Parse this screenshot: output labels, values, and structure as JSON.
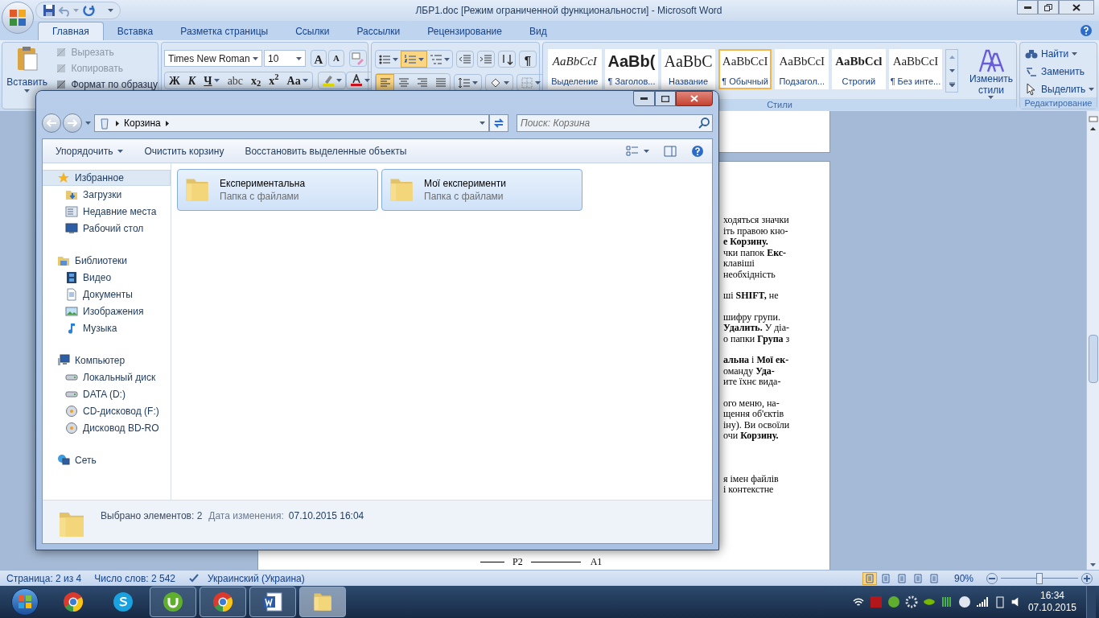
{
  "word": {
    "title": "ЛБР1.doc [Режим ограниченной функциональности] - Microsoft Word",
    "tabs": [
      {
        "label": "Главная",
        "selected": true
      },
      {
        "label": "Вставка",
        "selected": false
      },
      {
        "label": "Разметка страницы",
        "selected": false
      },
      {
        "label": "Ссылки",
        "selected": false
      },
      {
        "label": "Рассылки",
        "selected": false
      },
      {
        "label": "Рецензирование",
        "selected": false
      },
      {
        "label": "Вид",
        "selected": false
      }
    ],
    "clipboard": {
      "paste": "Вставить",
      "cut": {
        "label": "Вырезать",
        "disabled": true
      },
      "copy": {
        "label": "Копировать",
        "disabled": true
      },
      "format_painter": {
        "label": "Формат по образцу",
        "disabled": false
      }
    },
    "font": {
      "family": "Times New Roman",
      "size": "10",
      "grow": "A",
      "shrink": "A",
      "buttons": [
        {
          "label": "Ж",
          "kind": "bold",
          "dropdown": false
        },
        {
          "label": "К",
          "kind": "italic",
          "dropdown": false
        },
        {
          "label": "Ч",
          "kind": "underline",
          "dropdown": true
        },
        {
          "label": "abc",
          "kind": "strike",
          "dropdown": false
        },
        {
          "label": "x$_{2}$",
          "kind": "sub",
          "dropdown": false
        },
        {
          "label": "x$^{2}$",
          "kind": "sup",
          "dropdown": false
        },
        {
          "label": "Aa",
          "kind": "case",
          "dropdown": true
        }
      ]
    },
    "paragraph": {
      "lists": [
        {
          "kind": "bullets",
          "selected": false
        },
        {
          "kind": "numbering",
          "selected": true
        },
        {
          "kind": "multilevel",
          "selected": false
        }
      ],
      "pilcrow": "¶",
      "align": [
        {
          "kind": "left",
          "selected": true
        },
        {
          "kind": "center",
          "selected": false
        },
        {
          "kind": "right",
          "selected": false
        },
        {
          "kind": "justify",
          "selected": false
        }
      ]
    },
    "styles": {
      "label": "Стили",
      "change": "Изменить стили",
      "items": [
        {
          "preview": "AaBbCcI",
          "name": "Выделение",
          "kind": "emphasis",
          "selected": false
        },
        {
          "preview": "AaBb(",
          "name": "¶ Заголов...",
          "kind": "heading",
          "selected": false
        },
        {
          "preview": "AaBbC",
          "name": "Название",
          "kind": "title",
          "selected": false
        },
        {
          "preview": "AaBbCcI",
          "name": "¶ Обычный",
          "kind": "normal",
          "selected": true
        },
        {
          "preview": "AaBbCcI",
          "name": "Подзагол...",
          "kind": "normal",
          "selected": false
        },
        {
          "preview": "AaBbCcl",
          "name": "Строгий",
          "kind": "strong",
          "selected": false
        },
        {
          "preview": "AaBbCcI",
          "name": "¶ Без инте...",
          "kind": "normal",
          "selected": false
        }
      ]
    },
    "editing": {
      "label": "Редактирование",
      "find": "Найти",
      "replace": "Заменить",
      "select": "Выделить"
    }
  },
  "document": {
    "paragraphs": [
      [
        "ходяться значки",
        "іть правою кно-",
        "**е Корзину.**",
        "чки папок **Екс-**",
        "клавіші",
        "необхідність"
      ],
      [
        "ші **SHIFT,** не"
      ],
      [
        "шифру групи.",
        "**Удалить.** У діа-",
        "о папки **Група** з"
      ],
      [
        "**альна** і **Мої ек-**",
        "оманду **Уда-**",
        "ите їхнє вида-"
      ],
      [
        "ого меню, на-",
        "щення об'єктів",
        "іну). Ви освоїли",
        "очи **Корзину.**"
      ],
      [
        "я імен файлів",
        "і контекстне"
      ]
    ],
    "figure": {
      "left": "P2",
      "right": "A1"
    }
  },
  "status_bar": {
    "page": "Страница: 2 из 4",
    "words": "Число слов: 2 542",
    "language": "Украинский (Украина)",
    "views": [
      {
        "selected": true
      },
      {
        "selected": false
      },
      {
        "selected": false
      },
      {
        "selected": false
      },
      {
        "selected": false
      }
    ],
    "zoom": "90%",
    "zoom_slider": {
      "level": 0.5
    }
  },
  "explorer": {
    "address": "Корзина",
    "search": {
      "placeholder": "Поиск: Корзина"
    },
    "toolbar": [
      {
        "label": "Упорядочить",
        "dropdown": true
      },
      {
        "label": "Очистить корзину",
        "dropdown": false
      },
      {
        "label": "Восстановить выделенные объекты",
        "dropdown": false
      }
    ],
    "sidebar": [
      {
        "label": "Избранное",
        "kind": "star",
        "selected": true,
        "children": [
          {
            "label": "Загрузки",
            "kind": "download",
            "selected": false
          },
          {
            "label": "Недавние места",
            "kind": "recent",
            "selected": false
          },
          {
            "label": "Рабочий стол",
            "kind": "desktop",
            "selected": false
          }
        ]
      },
      {
        "label": "Библиотеки",
        "kind": "library",
        "selected": false,
        "children": [
          {
            "label": "Видео",
            "kind": "video",
            "selected": false
          },
          {
            "label": "Документы",
            "kind": "document",
            "selected": false
          },
          {
            "label": "Изображения",
            "kind": "picture",
            "selected": false
          },
          {
            "label": "Музыка",
            "kind": "music",
            "selected": false
          }
        ]
      },
      {
        "label": "Компьютер",
        "kind": "computer",
        "selected": false,
        "children": [
          {
            "label": "Локальный диск",
            "kind": "drive",
            "selected": false
          },
          {
            "label": "DATA (D:)",
            "kind": "drive",
            "selected": false
          },
          {
            "label": "CD-дисковод (F:)",
            "kind": "disc",
            "selected": false
          },
          {
            "label": "Дисковод BD-RO",
            "kind": "disc",
            "selected": false
          }
        ]
      },
      {
        "label": "Сеть",
        "kind": "network",
        "selected": false
      }
    ],
    "items": [
      {
        "name": "Експериментальна",
        "type": "Папка с файлами",
        "selected": true
      },
      {
        "name": "Мої експерименти",
        "type": "Папка с файлами",
        "selected": true
      }
    ],
    "details": {
      "count": "Выбрано элементов: 2",
      "date_label": "Дата изменения:",
      "date": "07.10.2015 16:04"
    }
  },
  "taskbar": {
    "apps": [
      {
        "kind": "browser",
        "running": false,
        "selected": false
      },
      {
        "kind": "chat",
        "running": false,
        "selected": false
      },
      {
        "kind": "torrent",
        "running": true,
        "selected": false
      },
      {
        "kind": "browser",
        "running": true,
        "selected": false
      },
      {
        "kind": "word",
        "running": true,
        "selected": false
      },
      {
        "kind": "folder",
        "running": true,
        "selected": true
      }
    ],
    "time": "16:34",
    "date": "07.10.2015"
  }
}
